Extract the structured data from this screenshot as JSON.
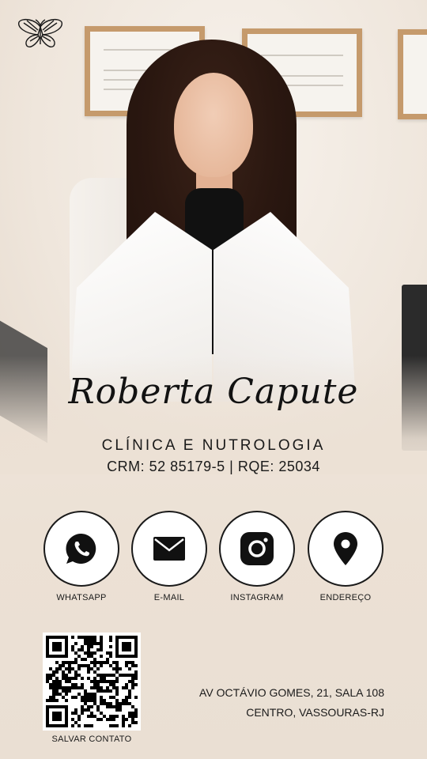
{
  "profile": {
    "name": "Roberta Capute",
    "specialty": "CLÍNICA E NUTROLOGIA",
    "registry": "CRM: 52 85179-5 |  RQE: 25034"
  },
  "branding": {
    "logo_icon": "butterfly-icon"
  },
  "contacts": [
    {
      "label": "WHATSAPP",
      "icon": "whatsapp-icon"
    },
    {
      "label": "E-MAIL",
      "icon": "mail-icon"
    },
    {
      "label": "INSTAGRAM",
      "icon": "instagram-icon"
    },
    {
      "label": "ENDEREÇO",
      "icon": "location-pin-icon"
    }
  ],
  "qr": {
    "caption": "SALVAR CONTATO"
  },
  "address": {
    "line1": "AV OCTÁVIO GOMES, 21, SALA 108",
    "line2": "CENTRO, VASSOURAS-RJ"
  },
  "colors": {
    "background": "#ece1d5",
    "ink": "#1a1a1a",
    "button_fill": "#ffffff"
  }
}
